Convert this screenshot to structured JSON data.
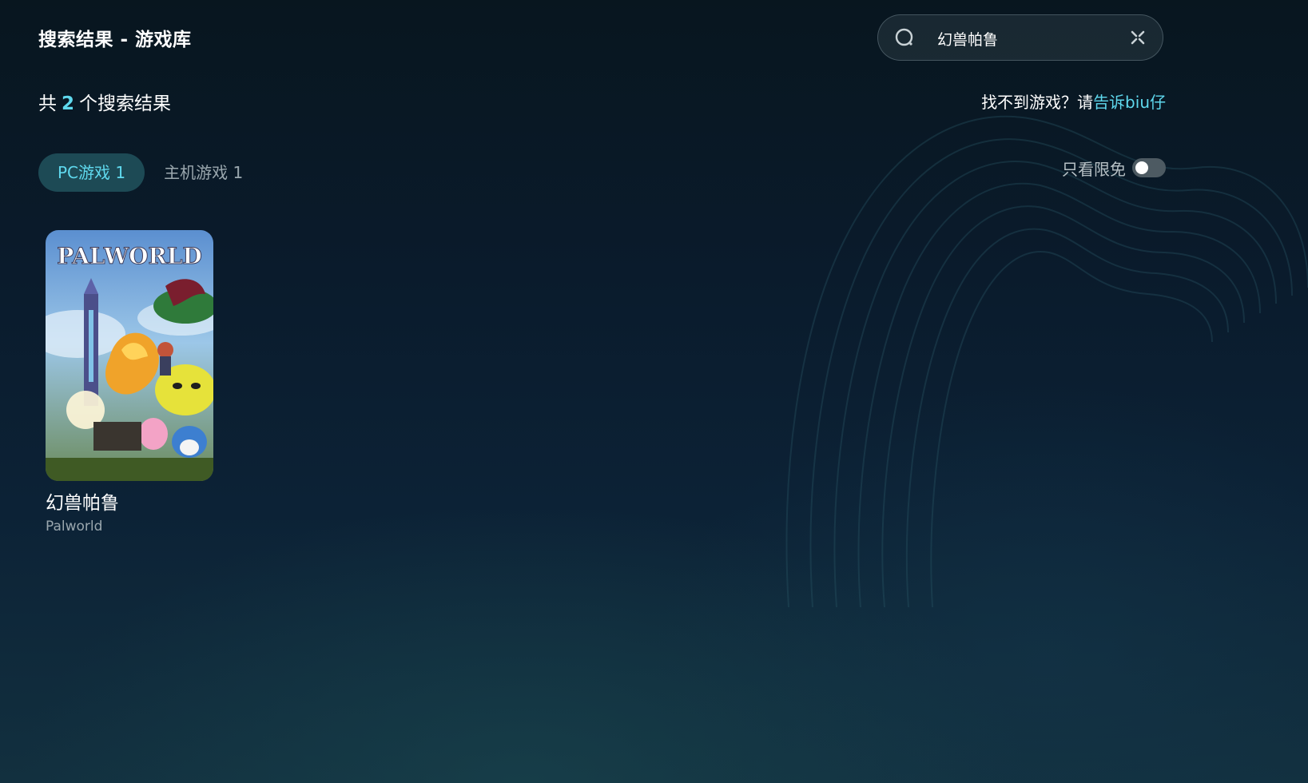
{
  "header": {
    "title": "搜索结果 - 游戏库"
  },
  "search": {
    "value": "幻兽帕鲁",
    "placeholder": ""
  },
  "results": {
    "prefix": "共",
    "count": "2",
    "suffix": "个搜索结果"
  },
  "feedback": {
    "text": "找不到游戏？请",
    "link": "告诉biu仔"
  },
  "tabs": [
    {
      "label": "PC游戏 1",
      "active": true
    },
    {
      "label": "主机游戏 1",
      "active": false
    }
  ],
  "filter": {
    "free_only_label": "只看限免",
    "free_only_enabled": false
  },
  "games": [
    {
      "title": "幻兽帕鲁",
      "subtitle": "Palworld",
      "cover_logo_text": "PALWORLD"
    }
  ],
  "colors": {
    "accent": "#5fd9ee",
    "active_tab_bg": "#1d4a55",
    "muted_text": "#9aa7ae"
  },
  "icons": {
    "search": "search-icon",
    "clear": "close-icon"
  }
}
